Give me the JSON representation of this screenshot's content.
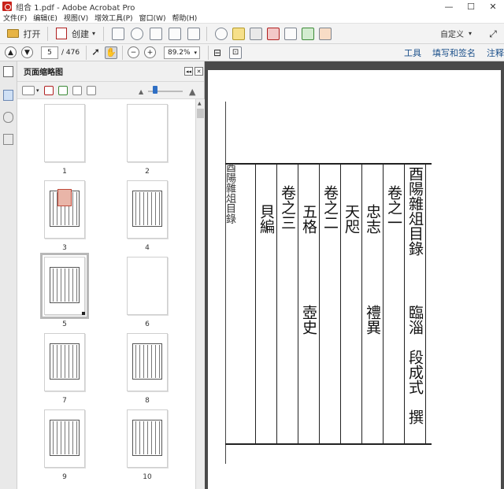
{
  "window": {
    "title": "组合 1.pdf - Adobe Acrobat Pro",
    "min": "—",
    "max": "☐",
    "close": "✕"
  },
  "menu": [
    "文件(F)",
    "编辑(E)",
    "视图(V)",
    "增效工具(P)",
    "窗口(W)",
    "帮助(H)"
  ],
  "toolbar": {
    "open_label": "打开",
    "create_label": "创建",
    "customize_label": "自定义"
  },
  "nav": {
    "page_value": "5",
    "page_total": "/ 476",
    "zoom_value": "89.2%"
  },
  "right_links": [
    "工具",
    "填写和签名",
    "注释"
  ],
  "panel": {
    "title": "页面缩略图"
  },
  "thumbnails": [
    {
      "label": "1",
      "kind": "blank"
    },
    {
      "label": "2",
      "kind": "blank"
    },
    {
      "label": "3",
      "kind": "seal"
    },
    {
      "label": "4",
      "kind": "text"
    },
    {
      "label": "5",
      "kind": "frame",
      "selected": true
    },
    {
      "label": "6",
      "kind": "blank"
    },
    {
      "label": "7",
      "kind": "frame"
    },
    {
      "label": "8",
      "kind": "frame"
    },
    {
      "label": "9",
      "kind": "frame"
    },
    {
      "label": "10",
      "kind": "frame"
    }
  ],
  "document": {
    "columns": [
      {
        "top": "酉陽雜俎目錄",
        "bottom": "臨淄　段成式　撰"
      },
      {
        "top": "卷之一",
        "bottom": ""
      },
      {
        "top": "忠志",
        "bottom": "禮異"
      },
      {
        "top": "天咫",
        "bottom": ""
      },
      {
        "top": "卷之二",
        "bottom": ""
      },
      {
        "top": "五格",
        "bottom": "壺史"
      },
      {
        "top": "卷之三",
        "bottom": ""
      },
      {
        "top": "貝編",
        "bottom": ""
      }
    ],
    "spine_text": "酉陽雜俎目錄"
  }
}
